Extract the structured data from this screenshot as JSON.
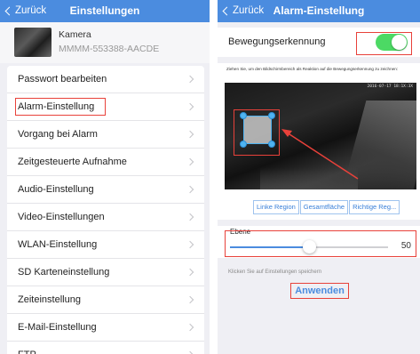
{
  "left": {
    "navbar": {
      "back_label": "Zurück",
      "title": "Einstellungen"
    },
    "camera": {
      "name": "Kamera",
      "id": "MMMM-553388-AACDE"
    },
    "menu_items": [
      {
        "label": "Passwort bearbeiten"
      },
      {
        "label": "Alarm-Einstellung"
      },
      {
        "label": "Vorgang bei Alarm"
      },
      {
        "label": "Zeitgesteuerte Aufnahme"
      },
      {
        "label": "Audio-Einstellung"
      },
      {
        "label": "Video-Einstellungen"
      },
      {
        "label": "WLAN-Einstellung"
      },
      {
        "label": "SD Karteneinstellung"
      },
      {
        "label": "Zeiteinstellung"
      },
      {
        "label": "E-Mail-Einstellung"
      },
      {
        "label": "FTP"
      }
    ]
  },
  "right": {
    "navbar": {
      "back_label": "Zurück",
      "title": "Alarm-Einstellung"
    },
    "motion_detection": {
      "label": "Bewegungserkennung",
      "enabled": true
    },
    "area": {
      "instruction": "Ziehen Sie, um den Bildschirmbereich als Reaktion auf die Bewegungserkennung zu zeichnen:",
      "timestamp": "2016-07-17 18:1X:3X",
      "buttons": [
        "Linke Region",
        "Gesamtfläche",
        "Richtige Reg..."
      ]
    },
    "level": {
      "label": "Ebene",
      "value": "50",
      "fraction": 0.5
    },
    "save_hint": "Klicken Sie auf Einstellungen speichern",
    "apply_label": "Anwenden"
  },
  "colors": {
    "navbar": "#4b8cdf",
    "highlight": "#e8413a",
    "toggle_on": "#4cd964",
    "region": "#4fb3f0"
  }
}
